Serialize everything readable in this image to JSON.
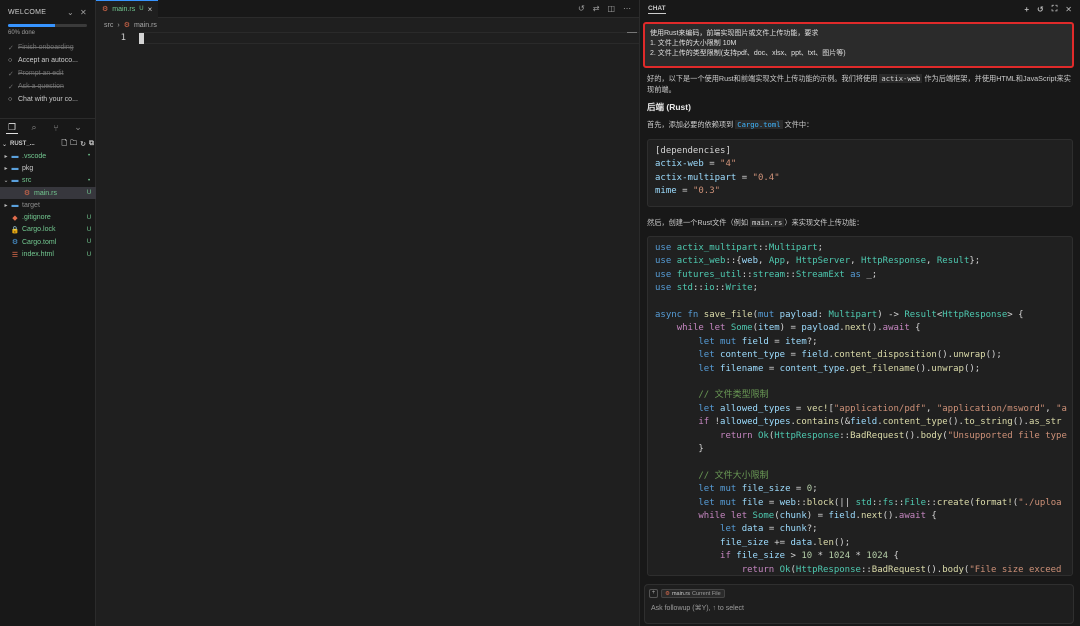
{
  "welcome": {
    "title": "WELCOME",
    "progress_fraction": 0.6,
    "progress_label": "60% done",
    "items": [
      {
        "label": "Finish onboarding",
        "done": true
      },
      {
        "label": "Accept an autoco...",
        "done": false
      },
      {
        "label": "Prompt an edit",
        "done": true
      },
      {
        "label": "Ask a question",
        "done": true
      },
      {
        "label": "Chat with your co...",
        "done": false
      }
    ]
  },
  "explorer": {
    "root": "RUST_...",
    "tree": [
      {
        "name": ".vscode",
        "kind": "folder",
        "badge": "•",
        "git": "git"
      },
      {
        "name": "pkg",
        "kind": "folder",
        "badge": "",
        "git": "none"
      },
      {
        "name": "src",
        "kind": "folder-open",
        "badge": "•",
        "git": "git"
      },
      {
        "name": "main.rs",
        "kind": "rust-file",
        "badge": "U",
        "git": "git"
      },
      {
        "name": "target",
        "kind": "folder",
        "badge": "",
        "git": "dim"
      },
      {
        "name": ".gitignore",
        "kind": "git-file",
        "badge": "U",
        "git": "git"
      },
      {
        "name": "Cargo.lock",
        "kind": "lock-file",
        "badge": "U",
        "git": "git"
      },
      {
        "name": "Cargo.toml",
        "kind": "config-file",
        "badge": "U",
        "git": "git"
      },
      {
        "name": "index.html",
        "kind": "html-file",
        "badge": "U",
        "git": "git"
      }
    ]
  },
  "editor": {
    "tab_name": "main.rs",
    "tab_badge": "U",
    "breadcrumb": [
      "src",
      "main.rs"
    ],
    "line_number": "1"
  },
  "chat": {
    "title": "CHAT",
    "user_message": [
      "使用Rust来编码，前端实现图片或文件上传功能，要求",
      "1. 文件上传的大小限制 10M",
      "2. 文件上传的类型限制(支持pdf、doc、xlsx、ppt、txt、图片等)"
    ],
    "intro_a": "好的，以下是一个使用Rust和前端实现文件上传功能的示例。我们将使用 ",
    "intro_code": "actix-web",
    "intro_b": " 作为后端框架，并使用HTML和JavaScript来实现前端。",
    "heading_backend": "后端 (Rust)",
    "deps_a": "首先，添加必要的依赖项到 ",
    "deps_code": "Cargo.toml",
    "deps_b": " 文件中：",
    "cargo_lines": [
      [
        [
          "cfg-h",
          "[dependencies]"
        ]
      ],
      [
        [
          "cfg-k",
          "actix-web"
        ],
        [
          "o",
          " = "
        ],
        [
          "s",
          "\"4\""
        ]
      ],
      [
        [
          "cfg-k",
          "actix-multipart"
        ],
        [
          "o",
          " = "
        ],
        [
          "s",
          "\"0.4\""
        ]
      ],
      [
        [
          "cfg-k",
          "mime"
        ],
        [
          "o",
          " = "
        ],
        [
          "s",
          "\"0.3\""
        ]
      ]
    ],
    "then_a": "然后，创建一个Rust文件（例如 ",
    "then_code": "main.rs",
    "then_b": "）来实现文件上传功能：",
    "rust_lines": [
      [
        [
          "k",
          "use "
        ],
        [
          "t",
          "actix_multipart"
        ],
        [
          "o",
          "::"
        ],
        [
          "t",
          "Multipart"
        ],
        [
          "o",
          ";"
        ]
      ],
      [
        [
          "k",
          "use "
        ],
        [
          "t",
          "actix_web"
        ],
        [
          "o",
          "::{"
        ],
        [
          "v",
          "web"
        ],
        [
          "o",
          ", "
        ],
        [
          "t",
          "App"
        ],
        [
          "o",
          ", "
        ],
        [
          "t",
          "HttpServer"
        ],
        [
          "o",
          ", "
        ],
        [
          "t",
          "HttpResponse"
        ],
        [
          "o",
          ", "
        ],
        [
          "t",
          "Result"
        ],
        [
          "o",
          "};"
        ]
      ],
      [
        [
          "k",
          "use "
        ],
        [
          "t",
          "futures_util"
        ],
        [
          "o",
          "::"
        ],
        [
          "t",
          "stream"
        ],
        [
          "o",
          "::"
        ],
        [
          "t",
          "StreamExt"
        ],
        [
          "k",
          " as "
        ],
        [
          "o",
          "_;"
        ]
      ],
      [
        [
          "k",
          "use "
        ],
        [
          "t",
          "std"
        ],
        [
          "o",
          "::"
        ],
        [
          "t",
          "io"
        ],
        [
          "o",
          "::"
        ],
        [
          "t",
          "Write"
        ],
        [
          "o",
          ";"
        ]
      ],
      [
        [
          "o",
          ""
        ]
      ],
      [
        [
          "k",
          "async fn "
        ],
        [
          "f",
          "save_file"
        ],
        [
          "o",
          "("
        ],
        [
          "k",
          "mut "
        ],
        [
          "v",
          "payload"
        ],
        [
          "o",
          ": "
        ],
        [
          "t",
          "Multipart"
        ],
        [
          "o",
          ") -> "
        ],
        [
          "t",
          "Result"
        ],
        [
          "o",
          "<"
        ],
        [
          "t",
          "HttpResponse"
        ],
        [
          "o",
          "> {"
        ]
      ],
      [
        [
          "o",
          "    "
        ],
        [
          "kw",
          "while let "
        ],
        [
          "t",
          "Some"
        ],
        [
          "o",
          "("
        ],
        [
          "v",
          "item"
        ],
        [
          "o",
          ") = "
        ],
        [
          "v",
          "payload"
        ],
        [
          "o",
          "."
        ],
        [
          "f",
          "next"
        ],
        [
          "o",
          "()."
        ],
        [
          "kw",
          "await"
        ],
        [
          "o",
          " {"
        ]
      ],
      [
        [
          "o",
          "        "
        ],
        [
          "k",
          "let mut "
        ],
        [
          "v",
          "field"
        ],
        [
          "o",
          " = "
        ],
        [
          "v",
          "item"
        ],
        [
          "o",
          "?;"
        ]
      ],
      [
        [
          "o",
          "        "
        ],
        [
          "k",
          "let "
        ],
        [
          "v",
          "content_type"
        ],
        [
          "o",
          " = "
        ],
        [
          "v",
          "field"
        ],
        [
          "o",
          "."
        ],
        [
          "f",
          "content_disposition"
        ],
        [
          "o",
          "()."
        ],
        [
          "f",
          "unwrap"
        ],
        [
          "o",
          "();"
        ]
      ],
      [
        [
          "o",
          "        "
        ],
        [
          "k",
          "let "
        ],
        [
          "v",
          "filename"
        ],
        [
          "o",
          " = "
        ],
        [
          "v",
          "content_type"
        ],
        [
          "o",
          "."
        ],
        [
          "f",
          "get_filename"
        ],
        [
          "o",
          "()."
        ],
        [
          "f",
          "unwrap"
        ],
        [
          "o",
          "();"
        ]
      ],
      [
        [
          "o",
          ""
        ]
      ],
      [
        [
          "o",
          "        "
        ],
        [
          "c",
          "// 文件类型限制"
        ]
      ],
      [
        [
          "o",
          "        "
        ],
        [
          "k",
          "let "
        ],
        [
          "v",
          "allowed_types"
        ],
        [
          "o",
          " = "
        ],
        [
          "f",
          "vec!"
        ],
        [
          "o",
          "["
        ],
        [
          "s",
          "\"application/pdf\""
        ],
        [
          "o",
          ", "
        ],
        [
          "s",
          "\"application/msword\""
        ],
        [
          "o",
          ", "
        ],
        [
          "s",
          "\"a"
        ]
      ],
      [
        [
          "o",
          "        "
        ],
        [
          "kw",
          "if "
        ],
        [
          "o",
          "!"
        ],
        [
          "v",
          "allowed_types"
        ],
        [
          "o",
          "."
        ],
        [
          "f",
          "contains"
        ],
        [
          "o",
          "(&"
        ],
        [
          "v",
          "field"
        ],
        [
          "o",
          "."
        ],
        [
          "f",
          "content_type"
        ],
        [
          "o",
          "()."
        ],
        [
          "f",
          "to_string"
        ],
        [
          "o",
          "()."
        ],
        [
          "f",
          "as_str"
        ]
      ],
      [
        [
          "o",
          "            "
        ],
        [
          "kw",
          "return "
        ],
        [
          "t",
          "Ok"
        ],
        [
          "o",
          "("
        ],
        [
          "t",
          "HttpResponse"
        ],
        [
          "o",
          "::"
        ],
        [
          "f",
          "BadRequest"
        ],
        [
          "o",
          "()."
        ],
        [
          "f",
          "body"
        ],
        [
          "o",
          "("
        ],
        [
          "s",
          "\"Unsupported file type"
        ]
      ],
      [
        [
          "o",
          "        }"
        ]
      ],
      [
        [
          "o",
          ""
        ]
      ],
      [
        [
          "o",
          "        "
        ],
        [
          "c",
          "// 文件大小限制"
        ]
      ],
      [
        [
          "o",
          "        "
        ],
        [
          "k",
          "let mut "
        ],
        [
          "v",
          "file_size"
        ],
        [
          "o",
          " = "
        ],
        [
          "n",
          "0"
        ],
        [
          "o",
          ";"
        ]
      ],
      [
        [
          "o",
          "        "
        ],
        [
          "k",
          "let mut "
        ],
        [
          "v",
          "file"
        ],
        [
          "o",
          " = "
        ],
        [
          "v",
          "web"
        ],
        [
          "o",
          "::"
        ],
        [
          "f",
          "block"
        ],
        [
          "o",
          "(|| "
        ],
        [
          "t",
          "std"
        ],
        [
          "o",
          "::"
        ],
        [
          "t",
          "fs"
        ],
        [
          "o",
          "::"
        ],
        [
          "t",
          "File"
        ],
        [
          "o",
          "::"
        ],
        [
          "f",
          "create"
        ],
        [
          "o",
          "("
        ],
        [
          "f",
          "format!"
        ],
        [
          "o",
          "("
        ],
        [
          "s",
          "\"./uploa"
        ]
      ],
      [
        [
          "o",
          "        "
        ],
        [
          "kw",
          "while let "
        ],
        [
          "t",
          "Some"
        ],
        [
          "o",
          "("
        ],
        [
          "v",
          "chunk"
        ],
        [
          "o",
          ") = "
        ],
        [
          "v",
          "field"
        ],
        [
          "o",
          "."
        ],
        [
          "f",
          "next"
        ],
        [
          "o",
          "()."
        ],
        [
          "kw",
          "await"
        ],
        [
          "o",
          " {"
        ]
      ],
      [
        [
          "o",
          "            "
        ],
        [
          "k",
          "let "
        ],
        [
          "v",
          "data"
        ],
        [
          "o",
          " = "
        ],
        [
          "v",
          "chunk"
        ],
        [
          "o",
          "?;"
        ]
      ],
      [
        [
          "o",
          "            "
        ],
        [
          "v",
          "file_size"
        ],
        [
          "o",
          " += "
        ],
        [
          "v",
          "data"
        ],
        [
          "o",
          "."
        ],
        [
          "f",
          "len"
        ],
        [
          "o",
          "();"
        ]
      ],
      [
        [
          "o",
          "            "
        ],
        [
          "kw",
          "if "
        ],
        [
          "v",
          "file_size"
        ],
        [
          "o",
          " > "
        ],
        [
          "n",
          "10"
        ],
        [
          "o",
          " * "
        ],
        [
          "n",
          "1024"
        ],
        [
          "o",
          " * "
        ],
        [
          "n",
          "1024"
        ],
        [
          "o",
          " {"
        ]
      ],
      [
        [
          "o",
          "                "
        ],
        [
          "kw",
          "return "
        ],
        [
          "t",
          "Ok"
        ],
        [
          "o",
          "("
        ],
        [
          "t",
          "HttpResponse"
        ],
        [
          "o",
          "::"
        ],
        [
          "f",
          "BadRequest"
        ],
        [
          "o",
          "()."
        ],
        [
          "f",
          "body"
        ],
        [
          "o",
          "("
        ],
        [
          "s",
          "\"File size exceed"
        ]
      ]
    ],
    "chip_file": "main.rs",
    "chip_tag": "Current File",
    "input_placeholder": "Ask followup (⌘Y), ↑ to select"
  },
  "colors": {
    "accent": "#3794ff",
    "git_untracked": "#73c991",
    "highlight_border": "#e02a2a",
    "rust_icon": "#e06c4c"
  }
}
